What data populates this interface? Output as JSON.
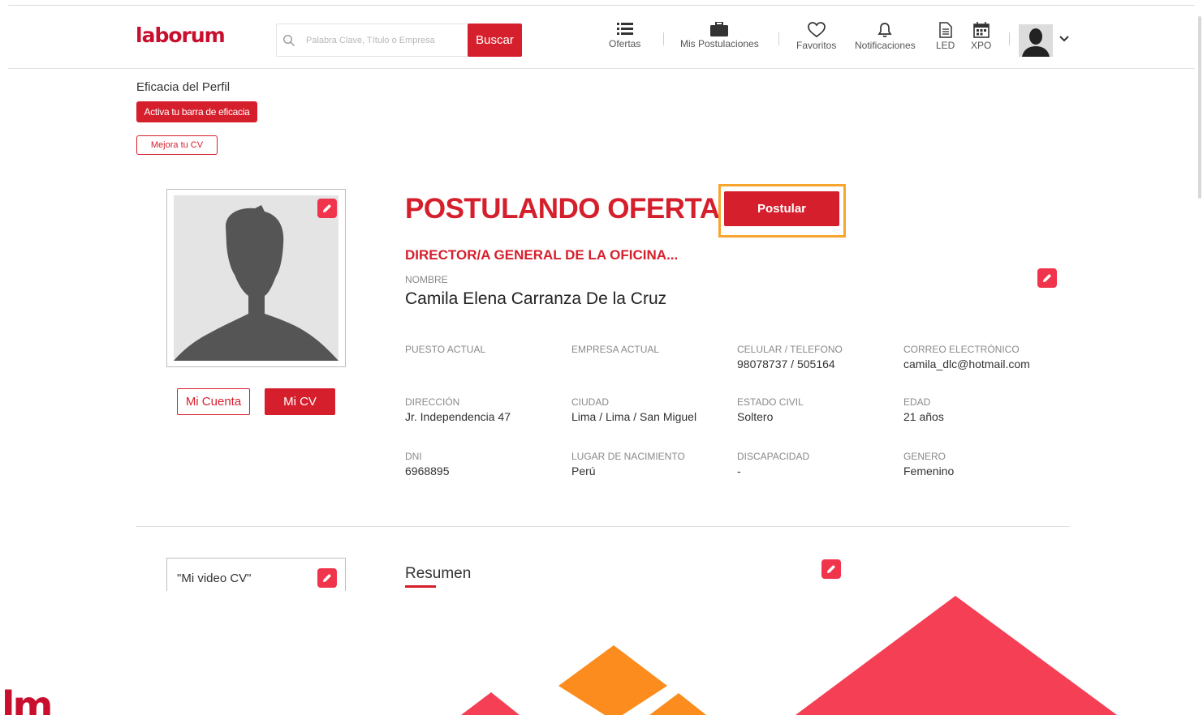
{
  "header": {
    "logo": "laborum",
    "search_placeholder": "Palabra Clave, Título o Empresa",
    "search_button": "Buscar",
    "nav": [
      {
        "label": "Ofertas",
        "icon": "list-icon"
      },
      {
        "label": "Mis Postulaciones",
        "icon": "briefcase-icon"
      },
      {
        "label": "Favoritos",
        "icon": "heart-icon"
      },
      {
        "label": "Notificaciones",
        "icon": "bell-icon"
      },
      {
        "label": "LED",
        "icon": "document-icon"
      },
      {
        "label": "XPO",
        "icon": "calendar-icon"
      }
    ]
  },
  "sidebar": {
    "eficacia_title": "Eficacia del Perfil",
    "activa_button": "Activa tu barra de eficacia",
    "mejora_button": "Mejora tu CV",
    "mi_cuenta": "Mi Cuenta",
    "mi_cv": "Mi CV",
    "video_label": "\"Mi video CV\""
  },
  "profile": {
    "heading": "POSTULANDO OFERTA",
    "postular_button": "Postular",
    "job_title": "DIRECTOR/A GENERAL DE LA OFICINA...",
    "name_label": "NOMBRE",
    "name": "Camila Elena Carranza De la Cruz",
    "fields": [
      {
        "label": "PUESTO ACTUAL",
        "value": ""
      },
      {
        "label": "EMPRESA ACTUAL",
        "value": ""
      },
      {
        "label": "CELULAR / TELEFONO",
        "value": "98078737 / 505164"
      },
      {
        "label": "CORREO ELECTRÓNICO",
        "value": "camila_dlc@hotmail.com"
      },
      {
        "label": "DIRECCIÓN",
        "value": "Jr. Independencia 47"
      },
      {
        "label": "CIUDAD",
        "value": "Lima / Lima / San Miguel"
      },
      {
        "label": "ESTADO CIVIL",
        "value": "Soltero"
      },
      {
        "label": "EDAD",
        "value": "21 años"
      },
      {
        "label": "DNI",
        "value": "6968895"
      },
      {
        "label": "LUGAR DE NACIMIENTO",
        "value": "Perú"
      },
      {
        "label": "DISCAPACIDAD",
        "value": "-"
      },
      {
        "label": "GENERO",
        "value": "Femenino"
      }
    ]
  },
  "resumen": {
    "title": "Resumen"
  },
  "colors": {
    "brand_red": "#d61f2c",
    "highlight_orange": "#f8a52e",
    "edit_pink": "#f0344c"
  }
}
